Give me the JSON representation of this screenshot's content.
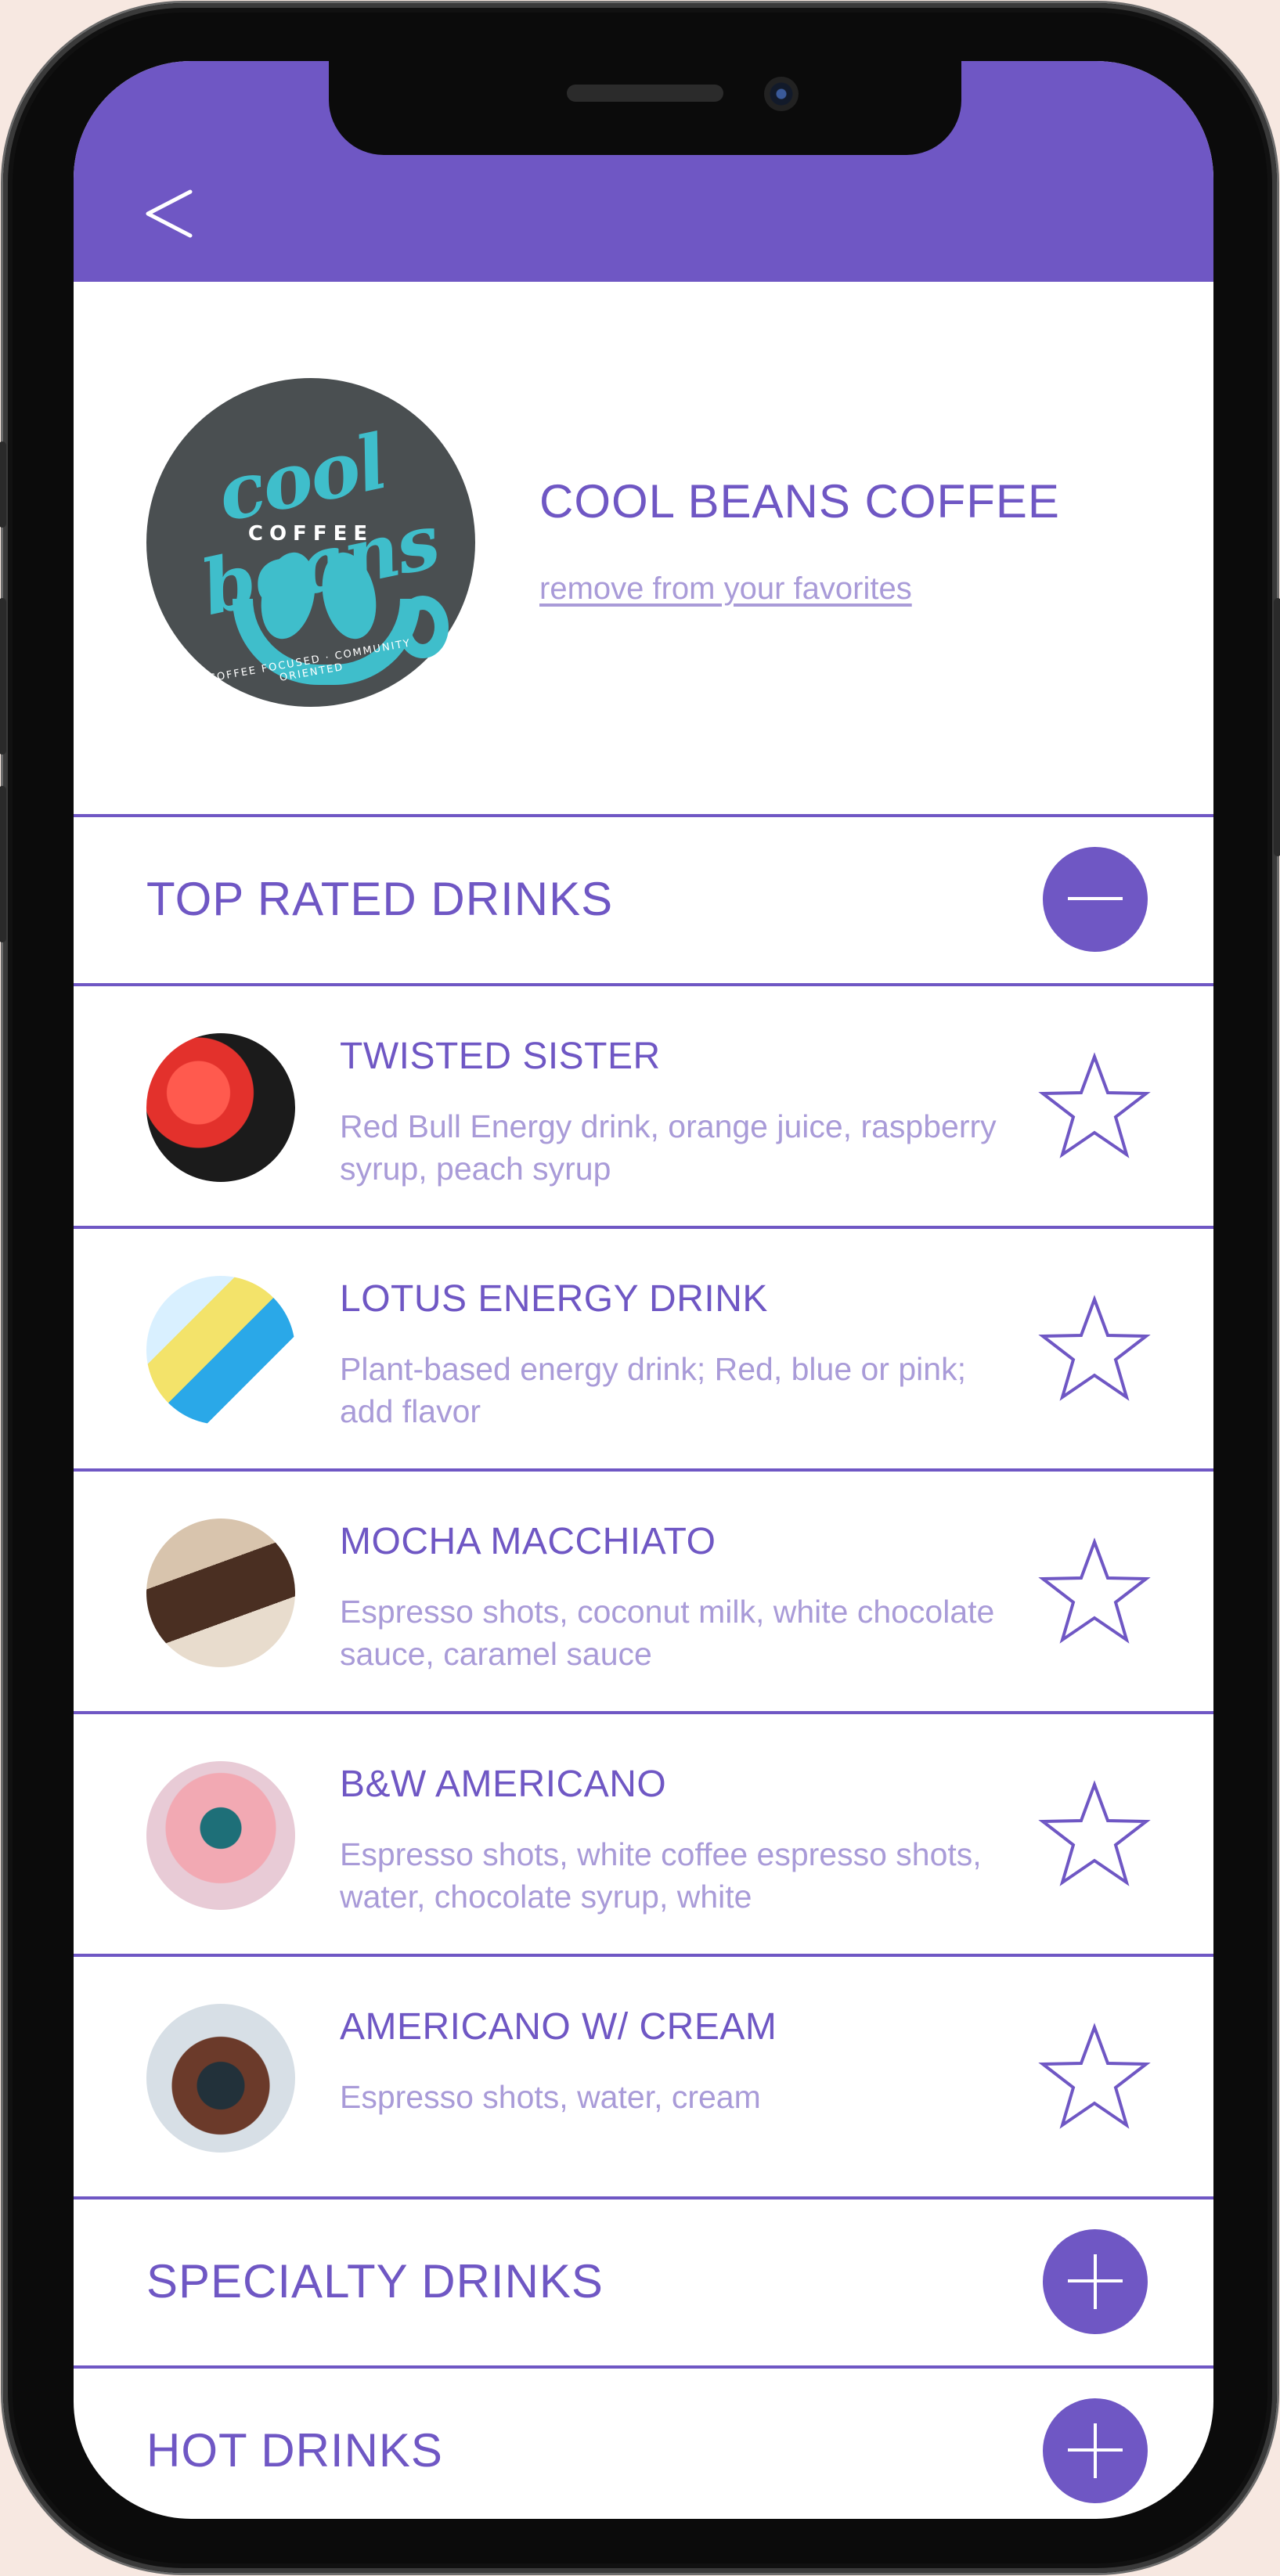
{
  "header": {
    "back_icon": "chevron-left-icon"
  },
  "shop": {
    "logo_script": "cool beans",
    "logo_word": "COFFEE",
    "logo_tagline": "COFFEE FOCUSED · COMMUNITY ORIENTED",
    "name": "COOL BEANS COFFEE",
    "remove_label": "remove from your favorites"
  },
  "sections": [
    {
      "label": "TOP RATED DRINKS",
      "state": "expanded",
      "icon": "minus-icon"
    },
    {
      "label": "SPECIALTY DRINKS",
      "state": "collapsed",
      "icon": "plus-icon"
    },
    {
      "label": "HOT DRINKS",
      "state": "collapsed",
      "icon": "plus-icon"
    }
  ],
  "drinks": [
    {
      "name": "TWISTED SISTER",
      "description": "Red Bull Energy drink, orange juice, raspberry syrup, peach syrup",
      "icon": "star-icon"
    },
    {
      "name": "LOTUS ENERGY DRINK",
      "description": "Plant-based energy drink; Red, blue or pink; add flavor",
      "icon": "star-icon"
    },
    {
      "name": "MOCHA MACCHIATO",
      "description": "Espresso shots, coconut milk, white chocolate sauce, caramel sauce",
      "icon": "star-icon"
    },
    {
      "name": "B&W AMERICANO",
      "description": "Espresso shots, white coffee espresso shots, water, chocolate syrup, white",
      "icon": "star-icon"
    },
    {
      "name": "AMERICANO W/ CREAM",
      "description": "Espresso shots, water, cream",
      "icon": "star-icon"
    }
  ],
  "colors": {
    "accent": "#6f57c4",
    "muted_text": "#a99bd8",
    "logo_teal": "#3fbecb",
    "logo_bg": "#4a4f51",
    "background": "#f7e8e1"
  }
}
